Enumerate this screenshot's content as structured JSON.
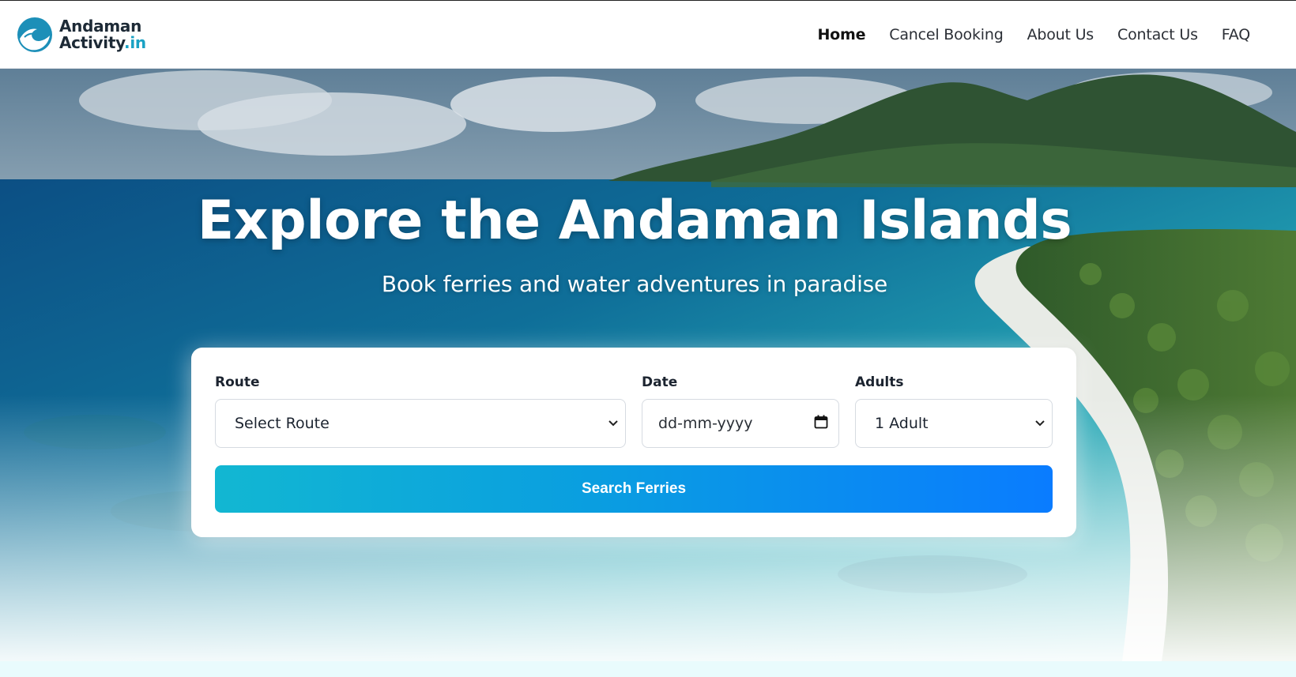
{
  "brand": {
    "name_line1": "Andaman",
    "name_line2": "Activity",
    "name_tld": ".in"
  },
  "nav": {
    "items": [
      {
        "label": "Home",
        "active": true
      },
      {
        "label": "Cancel Booking",
        "active": false
      },
      {
        "label": "About Us",
        "active": false
      },
      {
        "label": "Contact Us",
        "active": false
      },
      {
        "label": "FAQ",
        "active": false
      }
    ]
  },
  "hero": {
    "title": "Explore the Andaman Islands",
    "subtitle": "Book ferries and water adventures in paradise"
  },
  "search": {
    "route": {
      "label": "Route",
      "value": "Select Route"
    },
    "date": {
      "label": "Date",
      "placeholder": "dd-mm-yyyy"
    },
    "adults": {
      "label": "Adults",
      "value": "1 Adult"
    },
    "button_label": "Search Ferries"
  },
  "colors": {
    "accent_start": "#12b7d2",
    "accent_end": "#0a7cff",
    "brand_teal": "#1aa2c4",
    "text_dark": "#1c2430"
  },
  "icons": {
    "logo": "wave-logo-icon",
    "calendar": "calendar-icon",
    "chevron": "chevron-down-icon"
  }
}
